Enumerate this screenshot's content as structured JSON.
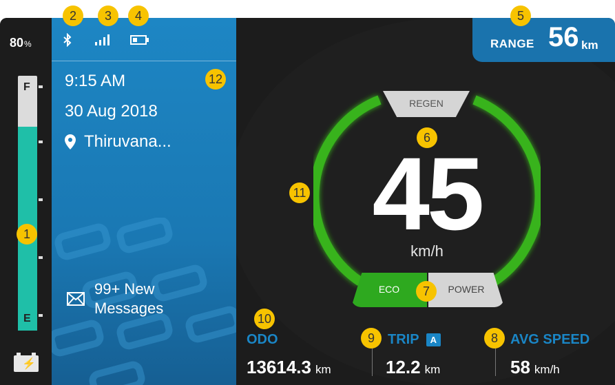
{
  "battery": {
    "percent": "80",
    "percent_unit": "%",
    "full_label": "F",
    "empty_label": "E",
    "level": 0.8
  },
  "status": {
    "bluetooth_icon": "bluetooth-icon",
    "signal_icon": "signal-bars-icon",
    "battery_icon": "battery-icon"
  },
  "info": {
    "time": "9:15 AM",
    "date": "30 Aug 2018",
    "location": "Thiruvana..."
  },
  "messages": {
    "line1": "99+ New",
    "line2": "Messages"
  },
  "range": {
    "label": "RANGE",
    "value": "56",
    "unit": "km"
  },
  "speedometer": {
    "speed": "45",
    "unit": "km/h",
    "regen_label": "REGEN",
    "eco_label": "ECO",
    "power_label": "POWER"
  },
  "odo": {
    "label": "ODO",
    "value": "13614.3",
    "unit": "km"
  },
  "trip": {
    "label": "TRIP",
    "badge": "A",
    "value": "12.2",
    "unit": "km"
  },
  "avg_speed": {
    "label": "AVG SPEED",
    "value": "58",
    "unit": "km/h"
  },
  "callouts": [
    "1",
    "2",
    "3",
    "4",
    "5",
    "6",
    "7",
    "8",
    "9",
    "10",
    "11",
    "12"
  ],
  "colors": {
    "accent_blue": "#1a86c6",
    "eco_green": "#2ea91f",
    "gauge_teal": "#1fbfa8",
    "callout_yellow": "#f7c300"
  }
}
